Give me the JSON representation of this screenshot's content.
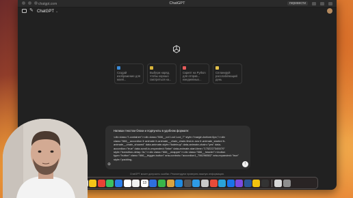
{
  "browser": {
    "url": "chatgpt.com",
    "title": "ChatGPT",
    "tab_right": "перевести"
  },
  "header": {
    "model_name": "ChatGPT",
    "model_chevron": "⌄",
    "new_chat_glyph": "✎"
  },
  "suggestions": [
    {
      "text": "Создай изображение для моей...",
      "icon_color": "#3a8bd8"
    },
    {
      "text": "Выбери наряд, чтобы хорошо смотреться на...",
      "icon_color": "#d8b43a"
    },
    {
      "text": "Скрипт на Python для отправ... ежедневных...",
      "icon_color": "#e65a5a"
    },
    {
      "text": "Спланируй расслабляющий день",
      "icon_color": "#e3c14a"
    }
  ],
  "composer": {
    "first_line": "Напиши текстом блоки и подпункты в удобном формате:",
    "body": "<div class=\"l-container\"><div class=\"666__col l-col l-col_7\" style=\"margin-bottom:6px;\"><div class=\"666__accordion fr animate fr-animate__chain_chain-first-in-row fr-animate_started fr-animate__chain_showed\" data-animate-style=\"fadeinup\" data-animate-chain=\"yes\" data-accordion=\"true\" data-scroll-to-expanded=\"false\" data-animate-start-time=\"1752227345070\" style=\"transition-delay: 0s;\"><div class=\"666__wrapper\"><div class=\"666__header\"><button type=\"button\" class=\"666__trigger-button\" aria-controls=\"accordion1_706296582\" aria-expanded=\"true\" style=\"padding-",
    "attach_glyph": "⊕",
    "send_glyph": "↑"
  },
  "disclaimer": "ChatGPT может допускать ошибки. Рекомендуем проверять важную информацию.",
  "dock": {
    "calendar_day": "13",
    "apps_left": [
      "#4a90e2",
      "#e8e8e8",
      "#f5c518",
      "#e94235",
      "#3cc060",
      "#2b7de9",
      "#ffffff",
      "#f2f2f2"
    ],
    "apps_mid": [
      "#2f6fde",
      "#39b54a",
      "#d9a441",
      "#1f8ae0",
      "#555555",
      "#2e9be6",
      "#c8c8c8",
      "#e84b3a",
      "#2aa3d9",
      "#1a73e8",
      "#7b4be0",
      "#2b5797",
      "#f1c40f",
      "#333333"
    ],
    "apps_right": [
      "#d7d7d7",
      "#8e8e8e"
    ]
  }
}
